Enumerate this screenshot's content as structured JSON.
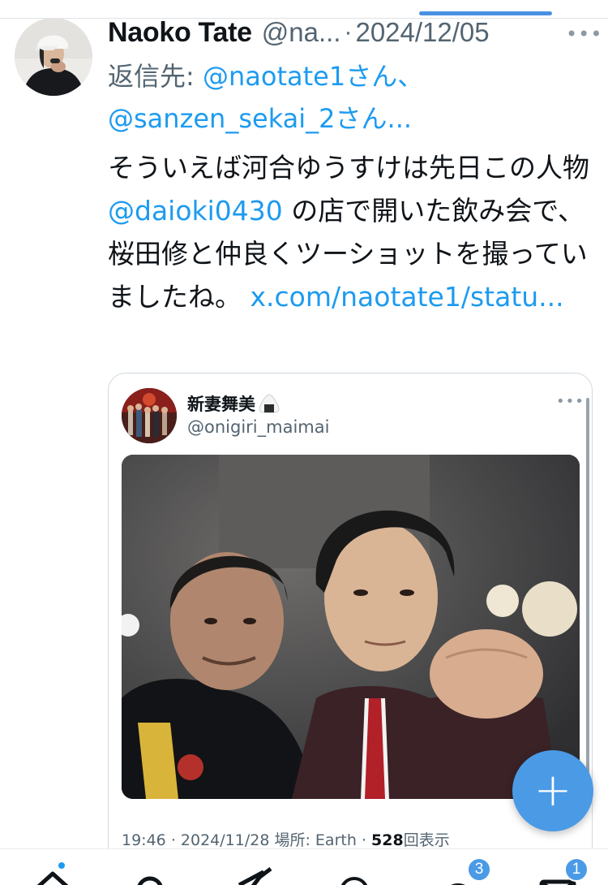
{
  "tweet": {
    "author": {
      "display_name": "Naoko Tate",
      "handle": "@na...",
      "separator": "·",
      "date": "2024/12/05"
    },
    "reply_to": {
      "prefix": "返信先: ",
      "mention1": "@naotate1",
      "san1": "さん、",
      "mention2": "@sanzen_sekai_2",
      "san2": "さん..."
    },
    "text": {
      "part1": "そういえば河合ゆうすけは先日この人物",
      "mention": "@daioki0430",
      "part2": "の店で開いた飲み会で、桜田修と仲良くツーショットを撮っていましたね。",
      "link": "x.com/naotate1/statu..."
    },
    "more_icon": "more-dots-icon"
  },
  "quote": {
    "display_name": "新妻舞美",
    "emoji": "onigiri-icon",
    "handle": "@onigiri_maimai",
    "meta": {
      "time": "19:46",
      "sep1": "·",
      "date": "2024/11/28",
      "location_label": "場所:",
      "location": "Earth",
      "sep2": "·",
      "views": "528",
      "views_label": "回表示"
    }
  },
  "fab": {
    "label": "+",
    "icon": "compose-plus-icon"
  },
  "bottom_nav": {
    "items": [
      {
        "name": "home-icon",
        "has_dot": true
      },
      {
        "name": "search-icon"
      },
      {
        "name": "grok-icon"
      },
      {
        "name": "spaces-icon"
      },
      {
        "name": "notifications-icon",
        "badge": "3"
      },
      {
        "name": "messages-icon",
        "badge": "1"
      }
    ]
  },
  "colors": {
    "link": "#1d9bf0",
    "text": "#0f1419",
    "secondary": "#536471",
    "fab": "#4a9ae6",
    "border": "#cfd9de"
  }
}
